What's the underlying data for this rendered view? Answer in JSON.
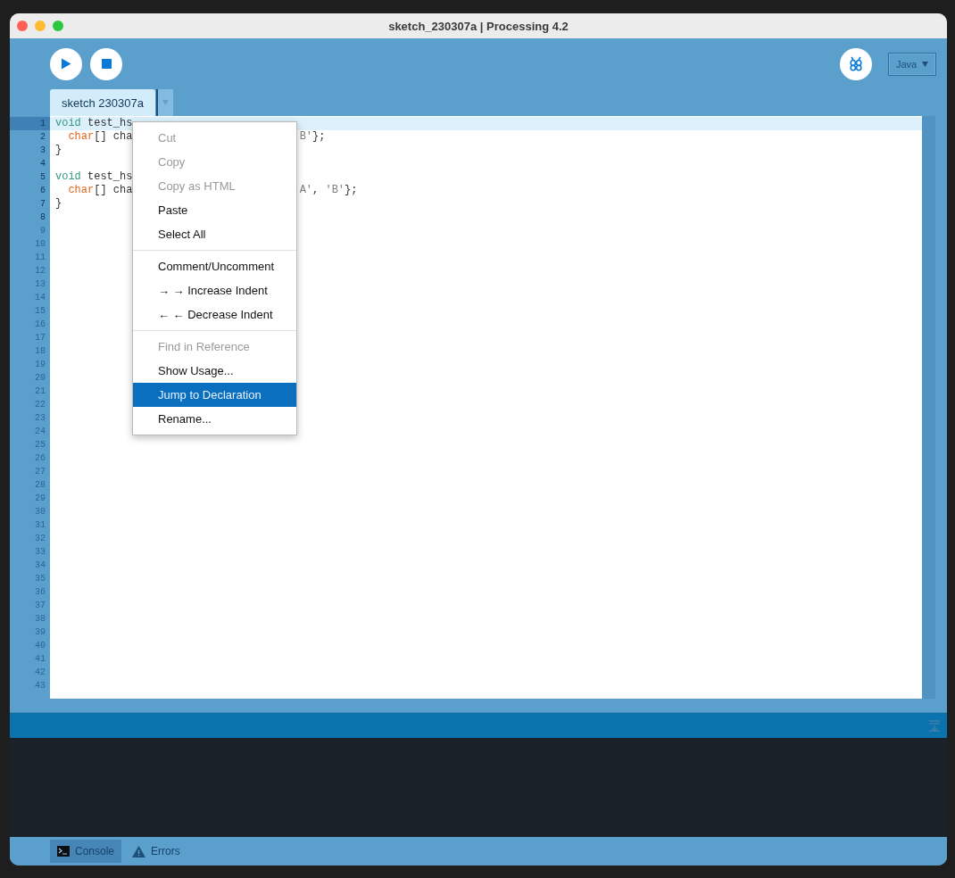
{
  "window": {
    "title": "sketch_230307a | Processing 4.2"
  },
  "toolbar": {
    "mode": "Java"
  },
  "tabs": [
    {
      "label": "sketch 230307a",
      "selected": true
    }
  ],
  "editor": {
    "lines": [
      {
        "number": "1",
        "current": true,
        "dim": false,
        "code": [
          {
            "text": "void",
            "kind": "keyword"
          },
          {
            "text": " test_hs",
            "kind": "plain"
          }
        ]
      },
      {
        "number": "2",
        "current": false,
        "dim": false,
        "indent": true,
        "code": [
          {
            "text": "char",
            "kind": "type"
          },
          {
            "text": "[] cha",
            "kind": "plain"
          }
        ],
        "tail": [
          {
            "text": "B'",
            "kind": "string"
          },
          {
            "text": "};",
            "kind": "plain"
          }
        ]
      },
      {
        "number": "3",
        "current": false,
        "dim": false,
        "code": [
          {
            "text": "}",
            "kind": "plain"
          }
        ]
      },
      {
        "number": "4",
        "current": false,
        "dim": false
      },
      {
        "number": "5",
        "current": false,
        "dim": false,
        "code": [
          {
            "text": "void",
            "kind": "keyword"
          },
          {
            "text": " test_hs",
            "kind": "plain"
          }
        ]
      },
      {
        "number": "6",
        "current": false,
        "dim": false,
        "indent": true,
        "code": [
          {
            "text": "char",
            "kind": "type"
          },
          {
            "text": "[] cha",
            "kind": "plain"
          }
        ],
        "tail": [
          {
            "text": "A'",
            "kind": "string"
          },
          {
            "text": ", ",
            "kind": "plain"
          },
          {
            "text": "'B'",
            "kind": "string"
          },
          {
            "text": "};",
            "kind": "plain"
          }
        ]
      },
      {
        "number": "7",
        "current": false,
        "dim": false,
        "code": [
          {
            "text": "}",
            "kind": "plain"
          }
        ]
      },
      {
        "number": "8",
        "current": false,
        "dim": false
      },
      {
        "number": "9",
        "current": false,
        "dim": true
      },
      {
        "number": "10",
        "current": false,
        "dim": true
      },
      {
        "number": "11",
        "current": false,
        "dim": true
      },
      {
        "number": "12",
        "current": false,
        "dim": true
      },
      {
        "number": "13",
        "current": false,
        "dim": true
      },
      {
        "number": "14",
        "current": false,
        "dim": true
      },
      {
        "number": "15",
        "current": false,
        "dim": true
      },
      {
        "number": "16",
        "current": false,
        "dim": true
      },
      {
        "number": "17",
        "current": false,
        "dim": true
      },
      {
        "number": "18",
        "current": false,
        "dim": true
      },
      {
        "number": "19",
        "current": false,
        "dim": true
      },
      {
        "number": "20",
        "current": false,
        "dim": true
      },
      {
        "number": "21",
        "current": false,
        "dim": true
      },
      {
        "number": "22",
        "current": false,
        "dim": true
      },
      {
        "number": "23",
        "current": false,
        "dim": true
      },
      {
        "number": "24",
        "current": false,
        "dim": true
      },
      {
        "number": "25",
        "current": false,
        "dim": true
      },
      {
        "number": "26",
        "current": false,
        "dim": true
      },
      {
        "number": "27",
        "current": false,
        "dim": true
      },
      {
        "number": "28",
        "current": false,
        "dim": true
      },
      {
        "number": "29",
        "current": false,
        "dim": true
      },
      {
        "number": "30",
        "current": false,
        "dim": true
      },
      {
        "number": "31",
        "current": false,
        "dim": true
      },
      {
        "number": "32",
        "current": false,
        "dim": true
      },
      {
        "number": "33",
        "current": false,
        "dim": true
      },
      {
        "number": "34",
        "current": false,
        "dim": true
      },
      {
        "number": "35",
        "current": false,
        "dim": true
      },
      {
        "number": "36",
        "current": false,
        "dim": true
      },
      {
        "number": "37",
        "current": false,
        "dim": true
      },
      {
        "number": "38",
        "current": false,
        "dim": true
      },
      {
        "number": "39",
        "current": false,
        "dim": true
      },
      {
        "number": "40",
        "current": false,
        "dim": true
      },
      {
        "number": "41",
        "current": false,
        "dim": true
      },
      {
        "number": "42",
        "current": false,
        "dim": true
      },
      {
        "number": "43",
        "current": false,
        "dim": true
      }
    ]
  },
  "context_menu": {
    "groups": [
      [
        {
          "label": "Cut",
          "disabled": true,
          "selected": false
        },
        {
          "label": "Copy",
          "disabled": true,
          "selected": false
        },
        {
          "label": "Copy as HTML",
          "disabled": true,
          "selected": false
        },
        {
          "label": "Paste",
          "disabled": false,
          "selected": false
        },
        {
          "label": "Select All",
          "disabled": false,
          "selected": false
        }
      ],
      [
        {
          "label": "Comment/Uncomment",
          "disabled": false,
          "selected": false
        },
        {
          "label": "→ → Increase Indent",
          "disabled": false,
          "selected": false
        },
        {
          "label": "← ← Decrease Indent",
          "disabled": false,
          "selected": false
        }
      ],
      [
        {
          "label": "Find in Reference",
          "disabled": true,
          "selected": false
        },
        {
          "label": "Show Usage...",
          "disabled": false,
          "selected": false
        },
        {
          "label": "Jump to Declaration",
          "disabled": false,
          "selected": true
        },
        {
          "label": "Rename...",
          "disabled": false,
          "selected": false
        }
      ]
    ]
  },
  "console_tabs": [
    {
      "label": "Console",
      "kind": "console",
      "selected": true
    },
    {
      "label": "Errors",
      "kind": "errors",
      "selected": false
    }
  ]
}
